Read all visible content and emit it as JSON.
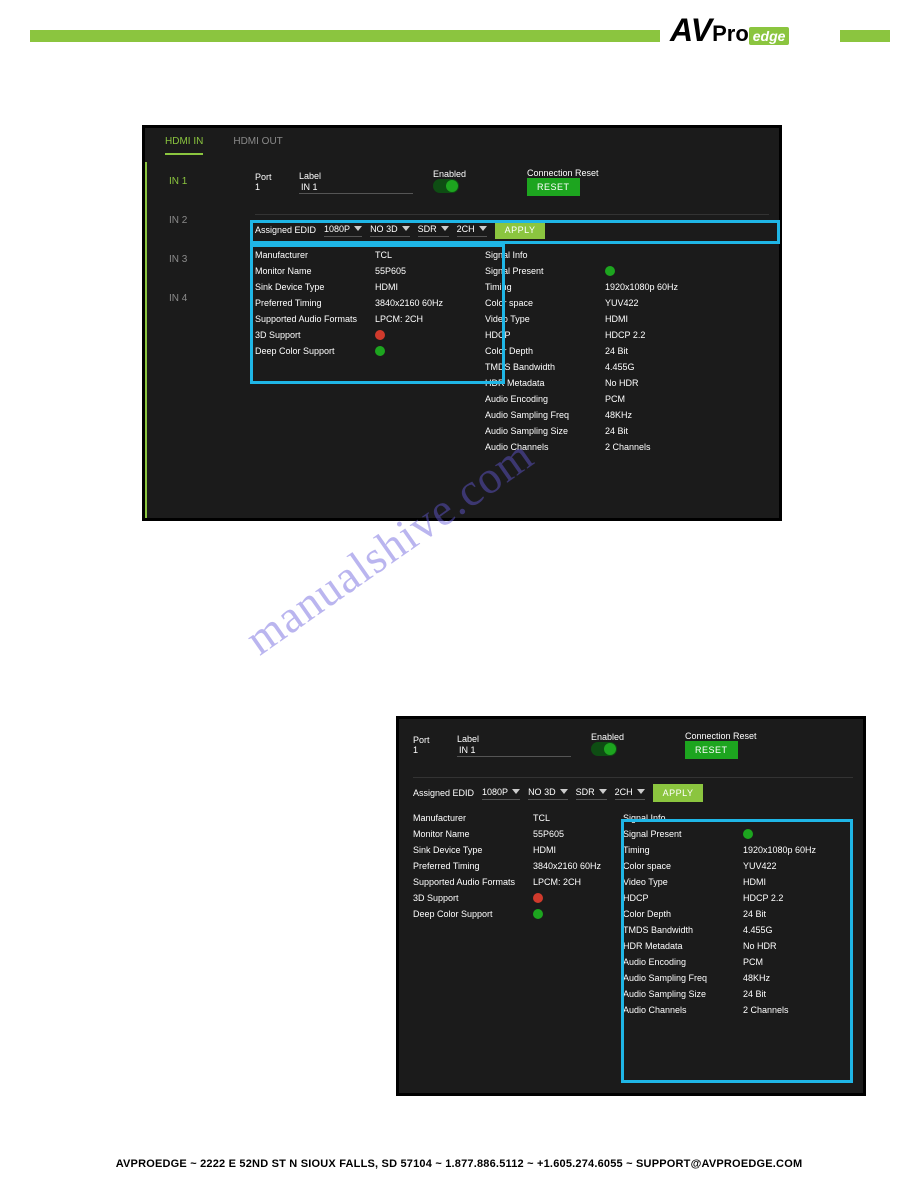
{
  "header": {
    "brand_av": "AV",
    "brand_pro": "Pro",
    "brand_edge": "edge"
  },
  "watermark": "manualshive.com",
  "footer": "AVPROEDGE  ~  2222 E 52ND ST N SIOUX FALLS, SD 57104  ~  1.877.886.5112  ~  +1.605.274.6055  ~  SUPPORT@AVPROEDGE.COM",
  "panel1": {
    "tabs": [
      "HDMI IN",
      "HDMI OUT"
    ],
    "side": [
      "IN 1",
      "IN 2",
      "IN 3",
      "IN 4"
    ],
    "hdr": {
      "port_lbl": "Port",
      "port": "1",
      "label_lbl": "Label",
      "label": "IN 1",
      "enabled_lbl": "Enabled",
      "cr_lbl": "Connection Reset",
      "reset": "RESET"
    },
    "edid": {
      "assigned": "Assigned EDID",
      "v1": "1080P",
      "v2": "NO 3D",
      "v3": "SDR",
      "v4": "2CH",
      "apply": "APPLY"
    },
    "left_info": [
      {
        "k": "Manufacturer",
        "v": "TCL"
      },
      {
        "k": "Monitor Name",
        "v": "55P605"
      },
      {
        "k": "Sink Device Type",
        "v": "HDMI"
      },
      {
        "k": "Preferred Timing",
        "v": "3840x2160 60Hz"
      },
      {
        "k": "Supported Audio Formats",
        "v": "LPCM: 2CH"
      },
      {
        "k": "3D Support",
        "dot": "red"
      },
      {
        "k": "Deep Color Support",
        "dot": "green"
      }
    ],
    "right_info_title": "Signal Info",
    "right_info": [
      {
        "k": "Signal Present",
        "dot": "green"
      },
      {
        "k": "Timing",
        "v": "1920x1080p 60Hz"
      },
      {
        "k": "Color space",
        "v": "YUV422"
      },
      {
        "k": "Video Type",
        "v": "HDMI"
      },
      {
        "k": "HDCP",
        "v": "HDCP 2.2"
      },
      {
        "k": "Color Depth",
        "v": "24 Bit"
      },
      {
        "k": "TMDS Bandwidth",
        "v": "4.455G"
      },
      {
        "k": "HDR Metadata",
        "v": "No HDR"
      },
      {
        "k": "Audio Encoding",
        "v": "PCM"
      },
      {
        "k": "Audio Sampling Freq",
        "v": "48KHz"
      },
      {
        "k": "Audio Sampling Size",
        "v": "24 Bit"
      },
      {
        "k": "Audio Channels",
        "v": "2 Channels"
      }
    ]
  },
  "panel2": {
    "hdr": {
      "port_lbl": "Port",
      "port": "1",
      "label_lbl": "Label",
      "label": "IN 1",
      "enabled_lbl": "Enabled",
      "cr_lbl": "Connection Reset",
      "reset": "RESET"
    },
    "edid": {
      "assigned": "Assigned EDID",
      "v1": "1080P",
      "v2": "NO 3D",
      "v3": "SDR",
      "v4": "2CH",
      "apply": "APPLY"
    },
    "left_info": [
      {
        "k": "Manufacturer",
        "v": "TCL"
      },
      {
        "k": "Monitor Name",
        "v": "55P605"
      },
      {
        "k": "Sink Device Type",
        "v": "HDMI"
      },
      {
        "k": "Preferred Timing",
        "v": "3840x2160 60Hz"
      },
      {
        "k": "Supported Audio Formats",
        "v": "LPCM: 2CH"
      },
      {
        "k": "3D Support",
        "dot": "red"
      },
      {
        "k": "Deep Color Support",
        "dot": "green"
      }
    ],
    "right_info_title": "Signal Info",
    "right_info": [
      {
        "k": "Signal Present",
        "dot": "green"
      },
      {
        "k": "Timing",
        "v": "1920x1080p 60Hz"
      },
      {
        "k": "Color space",
        "v": "YUV422"
      },
      {
        "k": "Video Type",
        "v": "HDMI"
      },
      {
        "k": "HDCP",
        "v": "HDCP 2.2"
      },
      {
        "k": "Color Depth",
        "v": "24 Bit"
      },
      {
        "k": "TMDS Bandwidth",
        "v": "4.455G"
      },
      {
        "k": "HDR Metadata",
        "v": "No HDR"
      },
      {
        "k": "Audio Encoding",
        "v": "PCM"
      },
      {
        "k": "Audio Sampling Freq",
        "v": "48KHz"
      },
      {
        "k": "Audio Sampling Size",
        "v": "24 Bit"
      },
      {
        "k": "Audio Channels",
        "v": "2 Channels"
      }
    ]
  }
}
